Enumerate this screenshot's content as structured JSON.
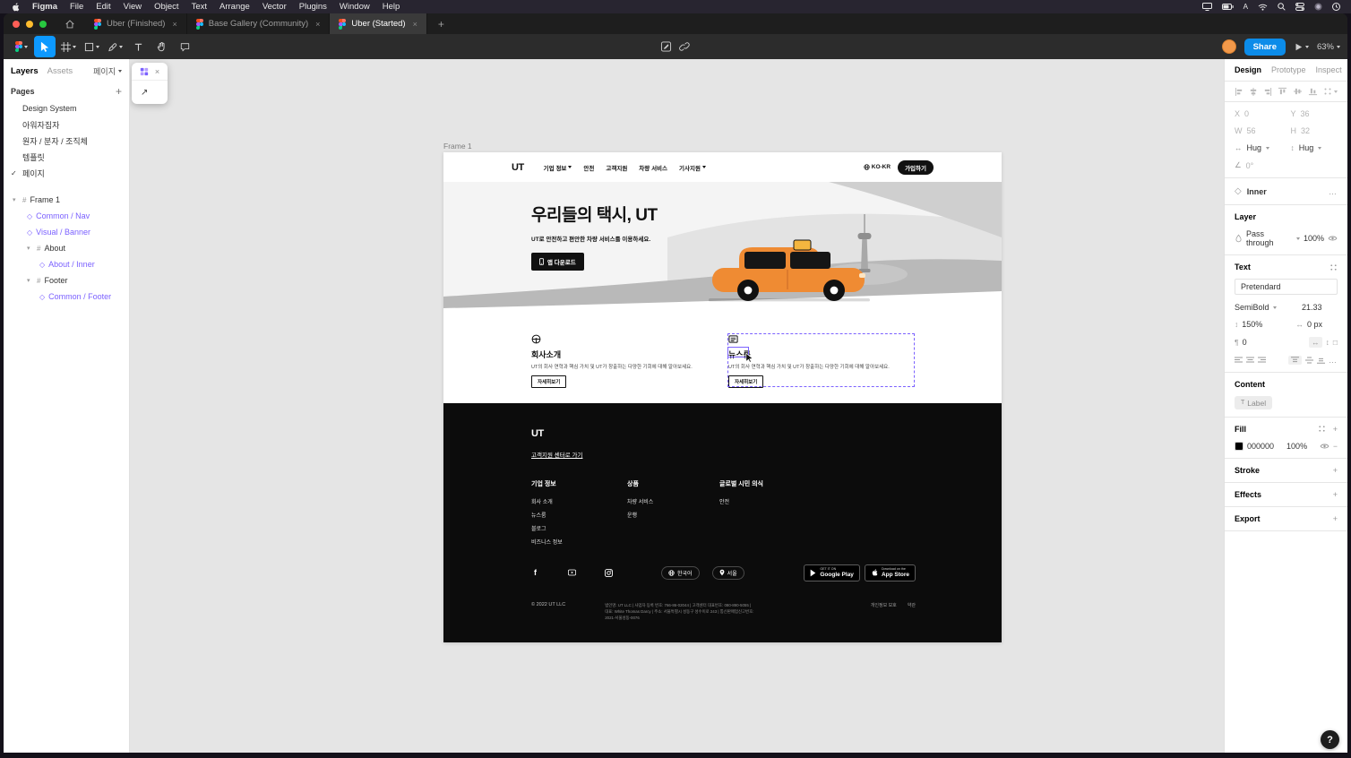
{
  "colors": {
    "accent_blue": "#0c8ce9",
    "component_purple": "#7b61ff",
    "taxi_orange": "#ef8b33",
    "fill_swatch": "#000000"
  },
  "menubar": {
    "app": "Figma",
    "items": [
      "File",
      "Edit",
      "View",
      "Object",
      "Text",
      "Arrange",
      "Vector",
      "Plugins",
      "Window",
      "Help"
    ]
  },
  "tabbar": {
    "tabs": [
      "Uber (Finished)",
      "Base Gallery (Community)",
      "Uber (Started)"
    ]
  },
  "toolbar": {
    "share_label": "Share",
    "zoom_level": "63%"
  },
  "layers_panel": {
    "tab_layers": "Layers",
    "tab_assets": "Assets",
    "page_dropdown": "페이지",
    "pages_header": "Pages",
    "pages": [
      "Design System",
      "아워자집자",
      "원자 / 분자 / 조직체",
      "템플릿",
      "페이지"
    ],
    "active_page": "페이지",
    "layers": [
      {
        "label": "Frame 1"
      },
      {
        "label": "Common / Nav"
      },
      {
        "label": "Visual / Banner"
      },
      {
        "label": "About"
      },
      {
        "label": "About / Inner"
      },
      {
        "label": "Footer"
      },
      {
        "label": "Common / Footer"
      }
    ]
  },
  "canvas": {
    "frame_label": "Frame 1",
    "site": {
      "header": {
        "logo": "UT",
        "nav": [
          "기업 정보",
          "안전",
          "고객지원",
          "차량 서비스",
          "기사지원"
        ],
        "locale": "KO-KR",
        "signup_label": "가입하기"
      },
      "hero": {
        "title": "우리들의 택시, UT",
        "subtitle": "UT로 안전하고 편안한 차량 서비스를 이용하세요.",
        "cta_label": "앱 다운로드"
      },
      "features": [
        {
          "title": "회사소개",
          "desc": "UT의 회사 연혁과 핵심 가치 및 UT가 창출하는 다양한 기회에 대해 알아보세요.",
          "cta": "자세히보기"
        },
        {
          "title": "뉴스룸",
          "desc": "UT의 회사 연혁과 핵심 가치 및 UT가 창출하는 다양한 기회에 대해 알아보세요.",
          "cta": "자세히보기"
        }
      ],
      "footer": {
        "logo": "UT",
        "support_link": "고객지원 센터로 가기",
        "columns": [
          {
            "title": "기업 정보",
            "links": [
              "회사 소개",
              "뉴스룸",
              "블로그",
              "비즈니스 정보"
            ]
          },
          {
            "title": "상품",
            "links": [
              "차량 서비스",
              "운행"
            ]
          },
          {
            "title": "글로벌 시민 의식",
            "links": [
              "안전"
            ]
          }
        ],
        "language_label": "한국어",
        "city_label": "서울",
        "google_play": {
          "top": "GET IT ON",
          "bottom": "Google Play"
        },
        "app_store": {
          "top": "Download on the",
          "bottom": "App Store"
        },
        "copyright": "© 2022 UT LLC",
        "legal_lines": [
          "법인명: UT LLC | 사업자 등록 번호: 766-86-02044 | 고객센터 대표번호: 080-890-5055 |",
          "대표: White Thomas Darcy | 주소: 서울특별시 성동구 성수이로 243 | 통신판매업신고번호:",
          "2021-서울성동-0076"
        ],
        "policy_links": [
          "개인정보 보호",
          "약관"
        ]
      }
    }
  },
  "inspector": {
    "tabs": [
      "Design",
      "Prototype",
      "Inspect"
    ],
    "position": {
      "x_label": "X",
      "x": "0",
      "y_label": "Y",
      "y": "36",
      "w_label": "W",
      "w": "56",
      "h_label": "H",
      "h": "32",
      "resize_h": "Hug",
      "resize_v": "Hug",
      "rotation": "0°"
    },
    "selection_name": "Inner",
    "layer_section": {
      "title": "Layer",
      "blend_mode": "Pass through",
      "opacity": "100%"
    },
    "text_section": {
      "title": "Text",
      "font_family": "Pretendard",
      "font_weight": "SemiBold",
      "font_size": "21.33",
      "line_height": "150%",
      "letter_spacing": "0 px",
      "paragraph_spacing": "0"
    },
    "content_section": {
      "title": "Content",
      "value": "Label"
    },
    "fill_section": {
      "title": "Fill",
      "hex": "000000",
      "opacity": "100%"
    },
    "stroke_section": {
      "title": "Stroke"
    },
    "effects_section": {
      "title": "Effects"
    },
    "export_section": {
      "title": "Export"
    },
    "help": "?"
  }
}
